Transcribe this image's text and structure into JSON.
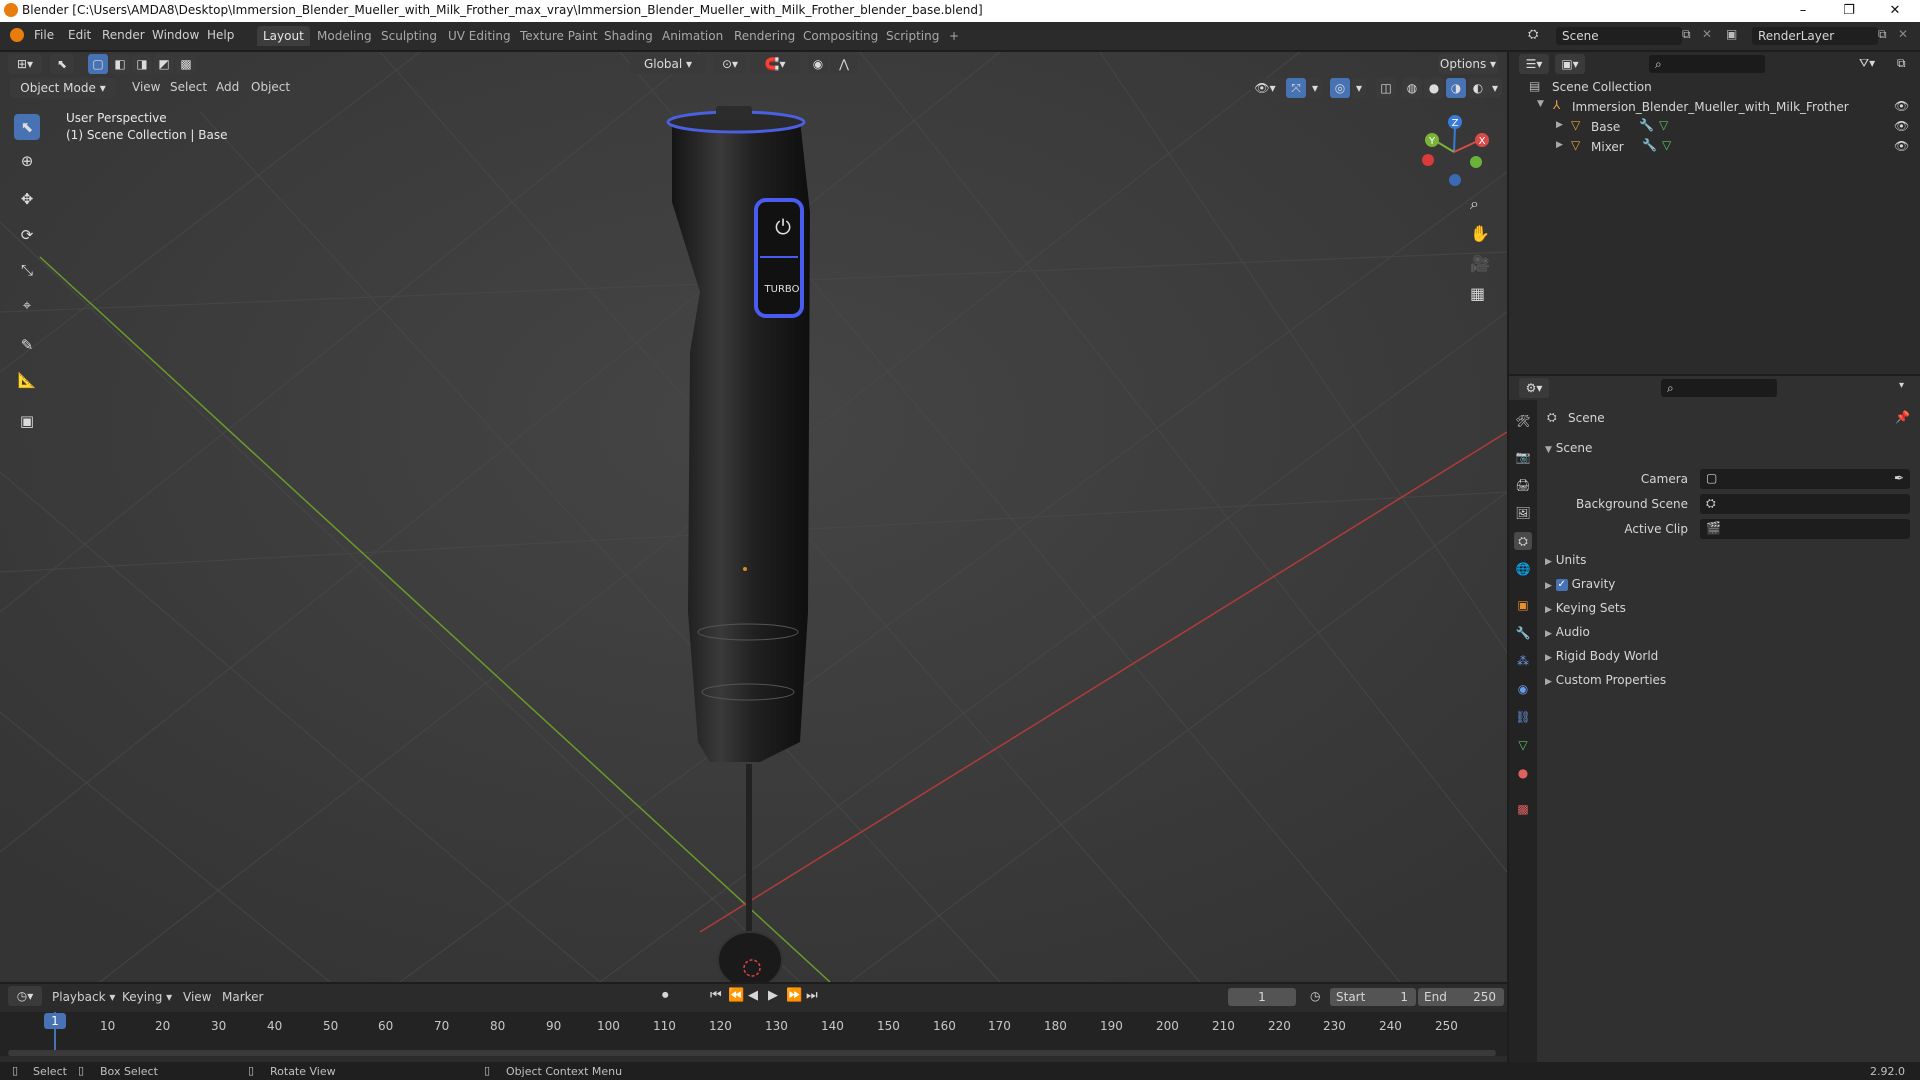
{
  "window": {
    "title": "Blender [C:\\Users\\AMDA8\\Desktop\\Immersion_Blender_Mueller_with_Milk_Frother_max_vray\\Immersion_Blender_Mueller_with_Milk_Frother_blender_base.blend]",
    "minimize": "–",
    "maximize": "❐",
    "close": "✕"
  },
  "menu": [
    "File",
    "Edit",
    "Render",
    "Window",
    "Help"
  ],
  "workspaces": [
    "Layout",
    "Modeling",
    "Sculpting",
    "UV Editing",
    "Texture Paint",
    "Shading",
    "Animation",
    "Rendering",
    "Compositing",
    "Scripting",
    "+"
  ],
  "scene_field": "Scene",
  "renderlayer_field": "RenderLayer",
  "viewport": {
    "mode": "Object Mode",
    "menus": [
      "View",
      "Select",
      "Add",
      "Object"
    ],
    "orientation": "Global",
    "options": "Options",
    "overlay_line1": "User Perspective",
    "overlay_line2": "(1) Scene Collection | Base",
    "gizmo": {
      "z": "Z",
      "y": "Y",
      "x": "X"
    },
    "product_button1": "⏻",
    "product_button2": "TURBO"
  },
  "outliner": {
    "root": "Scene Collection",
    "collection": "Immersion_Blender_Mueller_with_Milk_Frother",
    "items": [
      "Base",
      "Mixer"
    ]
  },
  "properties": {
    "header": "Scene",
    "section": "Scene",
    "fields": [
      {
        "label": "Camera"
      },
      {
        "label": "Background Scene"
      },
      {
        "label": "Active Clip"
      }
    ],
    "panels": [
      "Units",
      "Gravity",
      "Keying Sets",
      "Audio",
      "Rigid Body World",
      "Custom Properties"
    ],
    "gravity_checked": true
  },
  "timeline": {
    "menus": [
      "Playback",
      "Keying",
      "View",
      "Marker"
    ],
    "current_frame": "1",
    "start_label": "Start",
    "start_value": "1",
    "end_label": "End",
    "end_value": "250",
    "ticks": [
      "1",
      "10",
      "20",
      "30",
      "40",
      "50",
      "60",
      "70",
      "80",
      "90",
      "100",
      "110",
      "120",
      "130",
      "140",
      "150",
      "160",
      "170",
      "180",
      "190",
      "200",
      "210",
      "220",
      "230",
      "240",
      "250"
    ]
  },
  "statusbar": {
    "items": [
      "Select",
      "Box Select",
      "Rotate View",
      "Object Context Menu"
    ],
    "version": "2.92.0"
  },
  "colors": {
    "accent": "#4772b3",
    "x_axis": "#b33a3a",
    "y_axis": "#6a9a2a"
  }
}
